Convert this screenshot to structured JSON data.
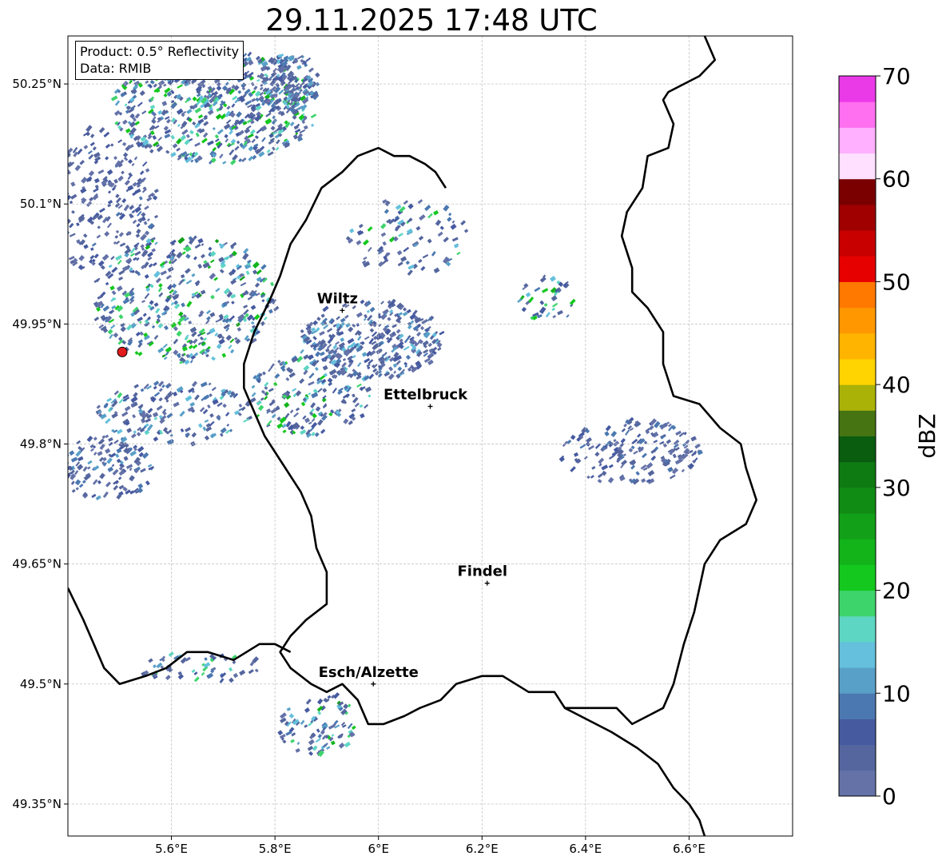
{
  "title": "29.11.2025 17:48 UTC",
  "info": {
    "product_line": "Product: 0.5° Reflectivity",
    "data_line": "Data: RMIB"
  },
  "map": {
    "extent": {
      "lon_min": 5.4,
      "lon_max": 6.8,
      "lat_min": 49.31,
      "lat_max": 50.31
    },
    "x_ticks": [
      {
        "value": 5.6,
        "label": "5.6°E"
      },
      {
        "value": 5.8,
        "label": "5.8°E"
      },
      {
        "value": 6.0,
        "label": "6°E"
      },
      {
        "value": 6.2,
        "label": "6.2°E"
      },
      {
        "value": 6.4,
        "label": "6.4°E"
      },
      {
        "value": 6.6,
        "label": "6.6°E"
      }
    ],
    "y_ticks": [
      {
        "value": 50.25,
        "label": "50.25°N"
      },
      {
        "value": 50.1,
        "label": "50.1°N"
      },
      {
        "value": 49.95,
        "label": "49.95°N"
      },
      {
        "value": 49.8,
        "label": "49.8°N"
      },
      {
        "value": 49.65,
        "label": "49.65°N"
      },
      {
        "value": 49.5,
        "label": "49.5°N"
      },
      {
        "value": 49.35,
        "label": "49.35°N"
      }
    ],
    "gridlines": true,
    "radar_site": {
      "lon": 5.505,
      "lat": 49.915,
      "color": "#e31a1c"
    },
    "cities": [
      {
        "name": "Wiltz",
        "lon": 5.93,
        "lat": 49.967
      },
      {
        "name": "Ettelbruck",
        "lon": 6.1,
        "lat": 49.847
      },
      {
        "name": "Findel",
        "lon": 6.21,
        "lat": 49.626
      },
      {
        "name": "Esch/Alzette",
        "lon": 5.99,
        "lat": 49.5
      }
    ],
    "country_border": [
      [
        6.63,
        50.31
      ],
      [
        6.65,
        50.28
      ],
      [
        6.62,
        50.26
      ],
      [
        6.56,
        50.24
      ],
      [
        6.55,
        50.23
      ],
      [
        6.57,
        50.2
      ],
      [
        6.56,
        50.17
      ],
      [
        6.52,
        50.16
      ],
      [
        6.51,
        50.12
      ],
      [
        6.48,
        50.09
      ],
      [
        6.47,
        50.06
      ],
      [
        6.49,
        50.02
      ],
      [
        6.49,
        49.99
      ],
      [
        6.52,
        49.97
      ],
      [
        6.55,
        49.94
      ],
      [
        6.55,
        49.9
      ],
      [
        6.57,
        49.86
      ],
      [
        6.62,
        49.85
      ],
      [
        6.66,
        49.82
      ],
      [
        6.7,
        49.8
      ],
      [
        6.71,
        49.77
      ],
      [
        6.73,
        49.73
      ],
      [
        6.71,
        49.7
      ],
      [
        6.66,
        49.68
      ],
      [
        6.63,
        49.65
      ],
      [
        6.61,
        49.59
      ],
      [
        6.59,
        49.55
      ],
      [
        6.57,
        49.5
      ],
      [
        6.55,
        49.47
      ],
      [
        6.52,
        49.46
      ],
      [
        6.49,
        49.45
      ],
      [
        6.46,
        49.47
      ],
      [
        6.42,
        49.47
      ],
      [
        6.36,
        49.47
      ],
      [
        6.34,
        49.49
      ],
      [
        6.29,
        49.49
      ],
      [
        6.24,
        49.51
      ],
      [
        6.2,
        49.51
      ],
      [
        6.15,
        49.5
      ],
      [
        6.12,
        49.48
      ],
      [
        6.08,
        49.47
      ],
      [
        6.05,
        49.46
      ],
      [
        6.01,
        49.45
      ],
      [
        5.98,
        49.45
      ],
      [
        5.96,
        49.48
      ],
      [
        5.93,
        49.5
      ],
      [
        5.9,
        49.49
      ],
      [
        5.87,
        49.5
      ],
      [
        5.83,
        49.52
      ],
      [
        5.81,
        49.54
      ],
      [
        5.83,
        49.56
      ],
      [
        5.86,
        49.58
      ],
      [
        5.9,
        49.6
      ],
      [
        5.9,
        49.64
      ],
      [
        5.88,
        49.67
      ],
      [
        5.87,
        49.71
      ],
      [
        5.85,
        49.74
      ],
      [
        5.81,
        49.78
      ],
      [
        5.78,
        49.81
      ],
      [
        5.76,
        49.84
      ],
      [
        5.74,
        49.87
      ],
      [
        5.74,
        49.9
      ],
      [
        5.76,
        49.94
      ],
      [
        5.79,
        49.98
      ],
      [
        5.81,
        50.01
      ],
      [
        5.83,
        50.05
      ],
      [
        5.86,
        50.08
      ],
      [
        5.89,
        50.12
      ],
      [
        5.93,
        50.14
      ],
      [
        5.96,
        50.16
      ],
      [
        6.0,
        50.17
      ],
      [
        6.03,
        50.16
      ],
      [
        6.06,
        50.16
      ],
      [
        6.09,
        50.15
      ],
      [
        6.11,
        50.14
      ],
      [
        6.13,
        50.12
      ]
    ],
    "border_fr_be": [
      [
        5.4,
        49.62
      ],
      [
        5.43,
        49.58
      ],
      [
        5.45,
        49.55
      ],
      [
        5.47,
        49.52
      ],
      [
        5.5,
        49.5
      ],
      [
        5.55,
        49.51
      ],
      [
        5.59,
        49.52
      ],
      [
        5.63,
        49.54
      ],
      [
        5.67,
        49.54
      ],
      [
        5.72,
        49.53
      ],
      [
        5.77,
        49.55
      ],
      [
        5.8,
        49.55
      ],
      [
        5.83,
        49.54
      ]
    ],
    "border_fr_de": [
      [
        6.36,
        49.47
      ],
      [
        6.39,
        49.46
      ],
      [
        6.45,
        49.44
      ],
      [
        6.5,
        49.42
      ],
      [
        6.54,
        49.4
      ],
      [
        6.57,
        49.37
      ],
      [
        6.6,
        49.35
      ],
      [
        6.62,
        49.33
      ],
      [
        6.63,
        49.31
      ]
    ],
    "dbz_bins": [
      {
        "min": 0,
        "color": "#6472a8"
      },
      {
        "min": 2.5,
        "color": "#55669e"
      },
      {
        "min": 5,
        "color": "#465aa0"
      },
      {
        "min": 7.5,
        "color": "#4b78b0"
      },
      {
        "min": 10,
        "color": "#58a0c8"
      },
      {
        "min": 12.5,
        "color": "#64c0dc"
      },
      {
        "min": 15,
        "color": "#5ed6c4"
      },
      {
        "min": 17.5,
        "color": "#3ed46c"
      },
      {
        "min": 20,
        "color": "#14c81e"
      },
      {
        "min": 22.5,
        "color": "#12b41a"
      },
      {
        "min": 25,
        "color": "#12a018"
      },
      {
        "min": 27.5,
        "color": "#108c14"
      },
      {
        "min": 30,
        "color": "#0e7a12"
      },
      {
        "min": 32.5,
        "color": "#0a5c0e"
      },
      {
        "min": 35,
        "color": "#467412"
      },
      {
        "min": 37.5,
        "color": "#aab208"
      },
      {
        "min": 40,
        "color": "#ffd400"
      },
      {
        "min": 42.5,
        "color": "#ffb400"
      },
      {
        "min": 45,
        "color": "#ff9800"
      },
      {
        "min": 47.5,
        "color": "#ff7800"
      },
      {
        "min": 50,
        "color": "#e60000"
      },
      {
        "min": 52.5,
        "color": "#c80000"
      },
      {
        "min": 55,
        "color": "#a00000"
      },
      {
        "min": 57.5,
        "color": "#7a0000"
      },
      {
        "min": 60,
        "color": "#ffe0ff"
      },
      {
        "min": 62.5,
        "color": "#ffb0ff"
      },
      {
        "min": 65,
        "color": "#ff70f0"
      },
      {
        "min": 67.5,
        "color": "#ea3ae8"
      }
    ],
    "echo_areas": [
      {
        "lon": 5.68,
        "lat": 50.22,
        "rlon": 0.2,
        "rlat": 0.07,
        "density": 0.55,
        "dbz": [
          2,
          24
        ]
      },
      {
        "lon": 5.82,
        "lat": 50.25,
        "rlon": 0.06,
        "rlat": 0.04,
        "density": 0.7,
        "dbz": [
          2,
          14
        ]
      },
      {
        "lon": 5.47,
        "lat": 50.1,
        "rlon": 0.1,
        "rlat": 0.1,
        "density": 0.3,
        "dbz": [
          2,
          8
        ]
      },
      {
        "lon": 5.62,
        "lat": 49.98,
        "rlon": 0.18,
        "rlat": 0.08,
        "density": 0.35,
        "dbz": [
          2,
          26
        ]
      },
      {
        "lon": 5.98,
        "lat": 49.93,
        "rlon": 0.14,
        "rlat": 0.05,
        "density": 0.6,
        "dbz": [
          2,
          14
        ]
      },
      {
        "lon": 5.86,
        "lat": 49.86,
        "rlon": 0.12,
        "rlat": 0.05,
        "density": 0.4,
        "dbz": [
          2,
          24
        ]
      },
      {
        "lon": 5.6,
        "lat": 49.84,
        "rlon": 0.15,
        "rlat": 0.04,
        "density": 0.35,
        "dbz": [
          2,
          18
        ]
      },
      {
        "lon": 5.47,
        "lat": 49.77,
        "rlon": 0.09,
        "rlat": 0.04,
        "density": 0.45,
        "dbz": [
          2,
          12
        ]
      },
      {
        "lon": 6.48,
        "lat": 49.79,
        "rlon": 0.14,
        "rlat": 0.04,
        "density": 0.4,
        "dbz": [
          2,
          10
        ]
      },
      {
        "lon": 5.88,
        "lat": 49.45,
        "rlon": 0.08,
        "rlat": 0.04,
        "density": 0.35,
        "dbz": [
          2,
          26
        ]
      },
      {
        "lon": 5.65,
        "lat": 49.52,
        "rlon": 0.12,
        "rlat": 0.02,
        "density": 0.3,
        "dbz": [
          2,
          20
        ]
      },
      {
        "lon": 6.05,
        "lat": 50.06,
        "rlon": 0.12,
        "rlat": 0.05,
        "density": 0.2,
        "dbz": [
          2,
          22
        ]
      },
      {
        "lon": 6.32,
        "lat": 49.98,
        "rlon": 0.06,
        "rlat": 0.03,
        "density": 0.3,
        "dbz": [
          2,
          24
        ]
      }
    ],
    "colorbar": {
      "label": "dBZ",
      "min": 0,
      "max": 70,
      "ticks": [
        0,
        10,
        20,
        30,
        40,
        50,
        60,
        70
      ]
    }
  }
}
